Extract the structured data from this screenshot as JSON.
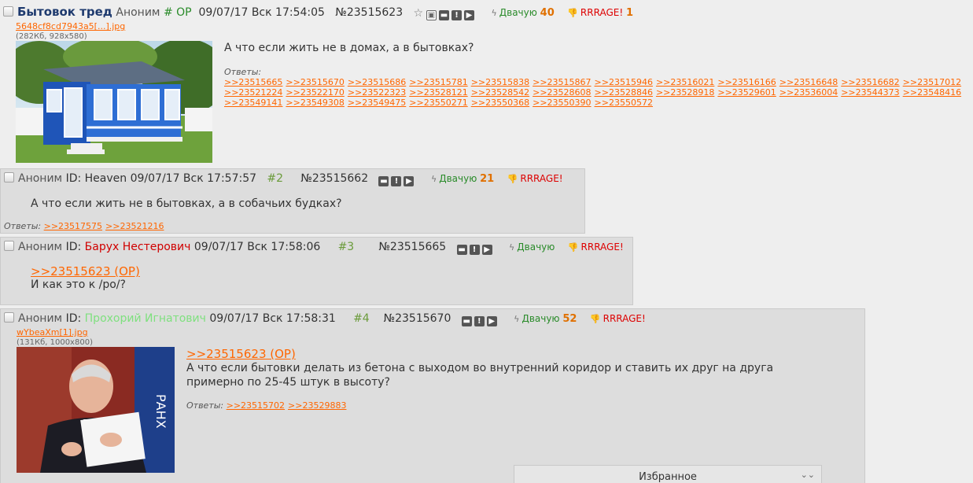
{
  "op": {
    "subject": "Бытовок тред",
    "author": "Аноним",
    "op_mark": "# OP",
    "date": "09/07/17 Вск 17:54:05",
    "number": "№23515623",
    "like_label": "Двачую",
    "like_count": "40",
    "dislike_label": "RRRAGE!",
    "dislike_count": "1",
    "file_name": "5648cf8cd7943a5[...].jpg",
    "file_meta": "(282Кб, 928x580)",
    "message": "А что если жить не в домах, а в бытовках?",
    "replies_label": "Ответы:",
    "replies": [
      ">>23515665",
      ">>23515670",
      ">>23515686",
      ">>23515781",
      ">>23515838",
      ">>23515867",
      ">>23515946",
      ">>23516021",
      ">>23516166",
      ">>23516648",
      ">>23516682",
      ">>23517012",
      ">>23521224",
      ">>23522170",
      ">>23522323",
      ">>23528121",
      ">>23528542",
      ">>23528608",
      ">>23528846",
      ">>23528918",
      ">>23529601",
      ">>23536004",
      ">>23544373",
      ">>23548416",
      ">>23549141",
      ">>23549308",
      ">>23549475",
      ">>23550271",
      ">>23550368",
      ">>23550390",
      ">>23550572"
    ]
  },
  "posts": [
    {
      "author": "Аноним",
      "id_label": "ID:",
      "id_name": "Heaven",
      "date": "09/07/17 Вск 17:57:57",
      "order": "#2",
      "number": "№23515662",
      "like_label": "Двачую",
      "like_count": "21",
      "dislike_label": "RRRAGE!",
      "message": "А что если жить не в бытовках, а в собачьих будках?",
      "replies_label": "Ответы:",
      "replies": [
        ">>23517575",
        ">>23521216"
      ]
    },
    {
      "author": "Аноним",
      "id_label": "ID:",
      "id_name": "Барух Нестерович",
      "date": "09/07/17 Вск 17:58:06",
      "order": "#3",
      "number": "№23515665",
      "like_label": "Двачую",
      "dislike_label": "RRRAGE!",
      "quote": ">>23515623 (OP)",
      "message": "И как это к /ро/?"
    },
    {
      "author": "Аноним",
      "id_label": "ID:",
      "id_name": "Прохорий Игнатович",
      "date": "09/07/17 Вск 17:58:31",
      "order": "#4",
      "number": "№23515670",
      "like_label": "Двачую",
      "like_count": "52",
      "dislike_label": "RRRAGE!",
      "file_name": "wYbeaXm[1].jpg",
      "file_meta": "(131Кб, 1000x800)",
      "quote": ">>23515623 (OP)",
      "message_1": "А что если бытовки делать из бетона с выходом во внутренний коридор и ставить их друг на друга",
      "message_2": "примерно по 25-45 штук в высоту?",
      "replies_label": "Ответы:",
      "replies": [
        ">>23515702",
        ">>23529883"
      ]
    }
  ],
  "favorites": {
    "label": "Избранное"
  },
  "colors": {
    "accent": "#ff6600",
    "like_green": "#2a8b2a",
    "rage_red": "#d00000",
    "count_orange": "#e07000"
  }
}
